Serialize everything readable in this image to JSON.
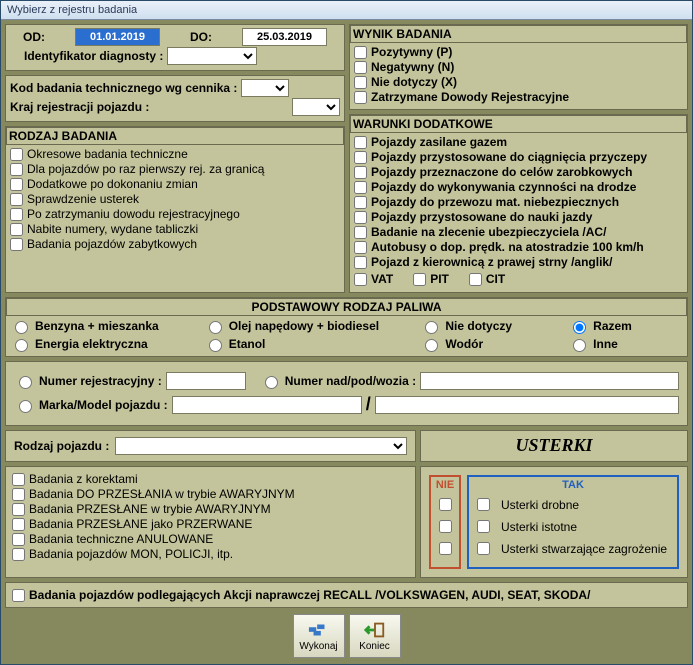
{
  "window": {
    "title": "Wybierz z rejestru badania"
  },
  "dates": {
    "od_label": "OD:",
    "od_value": "01.01.2019",
    "do_label": "DO:",
    "do_value": "25.03.2019",
    "ident_label": "Identyfikator diagnosty :",
    "kod_label": "Kod badania technicznego wg cennika :",
    "kraj_label": "Kraj rejestracji pojazdu :"
  },
  "wynik": {
    "title": "WYNIK BADANIA",
    "items": [
      "Pozytywny  (P)",
      "Negatywny  (N)",
      "Nie dotyczy  (X)",
      "Zatrzymane Dowody Rejestracyjne"
    ]
  },
  "rodzaj": {
    "title": "RODZAJ BADANIA",
    "items": [
      "Okresowe badania techniczne",
      "Dla pojazdów po raz pierwszy rej. za granicą",
      "Dodatkowe po dokonaniu zmian",
      "Sprawdzenie usterek",
      "Po zatrzymaniu dowodu rejestracyjnego",
      "Nabite numery, wydane tabliczki",
      "Badania pojazdów zabytkowych"
    ]
  },
  "warunki": {
    "title": "WARUNKI DODATKOWE",
    "items": [
      "Pojazdy zasilane gazem",
      "Pojazdy przystosowane do ciągnięcia przyczepy",
      "Pojazdy przeznaczone do celów zarobkowych",
      "Pojazdy do wykonywania czynności na drodze",
      "Pojazdy do przewozu mat. niebezpiecznych",
      "Pojazdy przystosowane do nauki jazdy",
      "Badanie na zlecenie ubezpieczyciela /AC/",
      "Autobusy o dop. prędk. na atostradzie 100 km/h",
      "Pojazd z kierownicą z prawej strny /anglik/"
    ],
    "tax": {
      "vat": "VAT",
      "pit": "PIT",
      "cit": "CIT"
    }
  },
  "paliwo": {
    "title": "PODSTAWOWY  RODZAJ PALIWA",
    "items": [
      "Benzyna + mieszanka",
      "Olej napędowy + biodiesel",
      "Nie dotyczy",
      "Razem",
      "Energia elektryczna",
      "Etanol",
      "Wodór",
      "Inne"
    ],
    "selected": "Razem"
  },
  "search": {
    "nr_rej": "Numer rejestracyjny :",
    "nr_npw": "Numer nad/pod/wozia :",
    "marka": "Marka/Model pojazdu :"
  },
  "rodzaj_pojazdu": {
    "label": "Rodzaj pojazdu :"
  },
  "usterki": {
    "title": "USTERKI",
    "nie": "NIE",
    "tak": "TAK",
    "rows": [
      "Usterki drobne",
      "Usterki istotne",
      "Usterki stwarzające zagrożenie"
    ]
  },
  "filters": {
    "items": [
      "Badania z korektami",
      "Badania DO PRZESŁANIA w trybie AWARYJNYM",
      "Badania PRZESŁANE w trybie AWARYJNYM",
      "Badania PRZESŁANE jako PRZERWANE",
      "Badania techniczne ANULOWANE",
      "Badania pojazdów MON, POLICJI, itp."
    ]
  },
  "recall": {
    "label": "Badania pojazdów podlegających Akcji naprawczej RECALL /VOLKSWAGEN, AUDI, SEAT, SKODA/"
  },
  "buttons": {
    "wykonaj": "Wykonaj",
    "koniec": "Koniec"
  }
}
